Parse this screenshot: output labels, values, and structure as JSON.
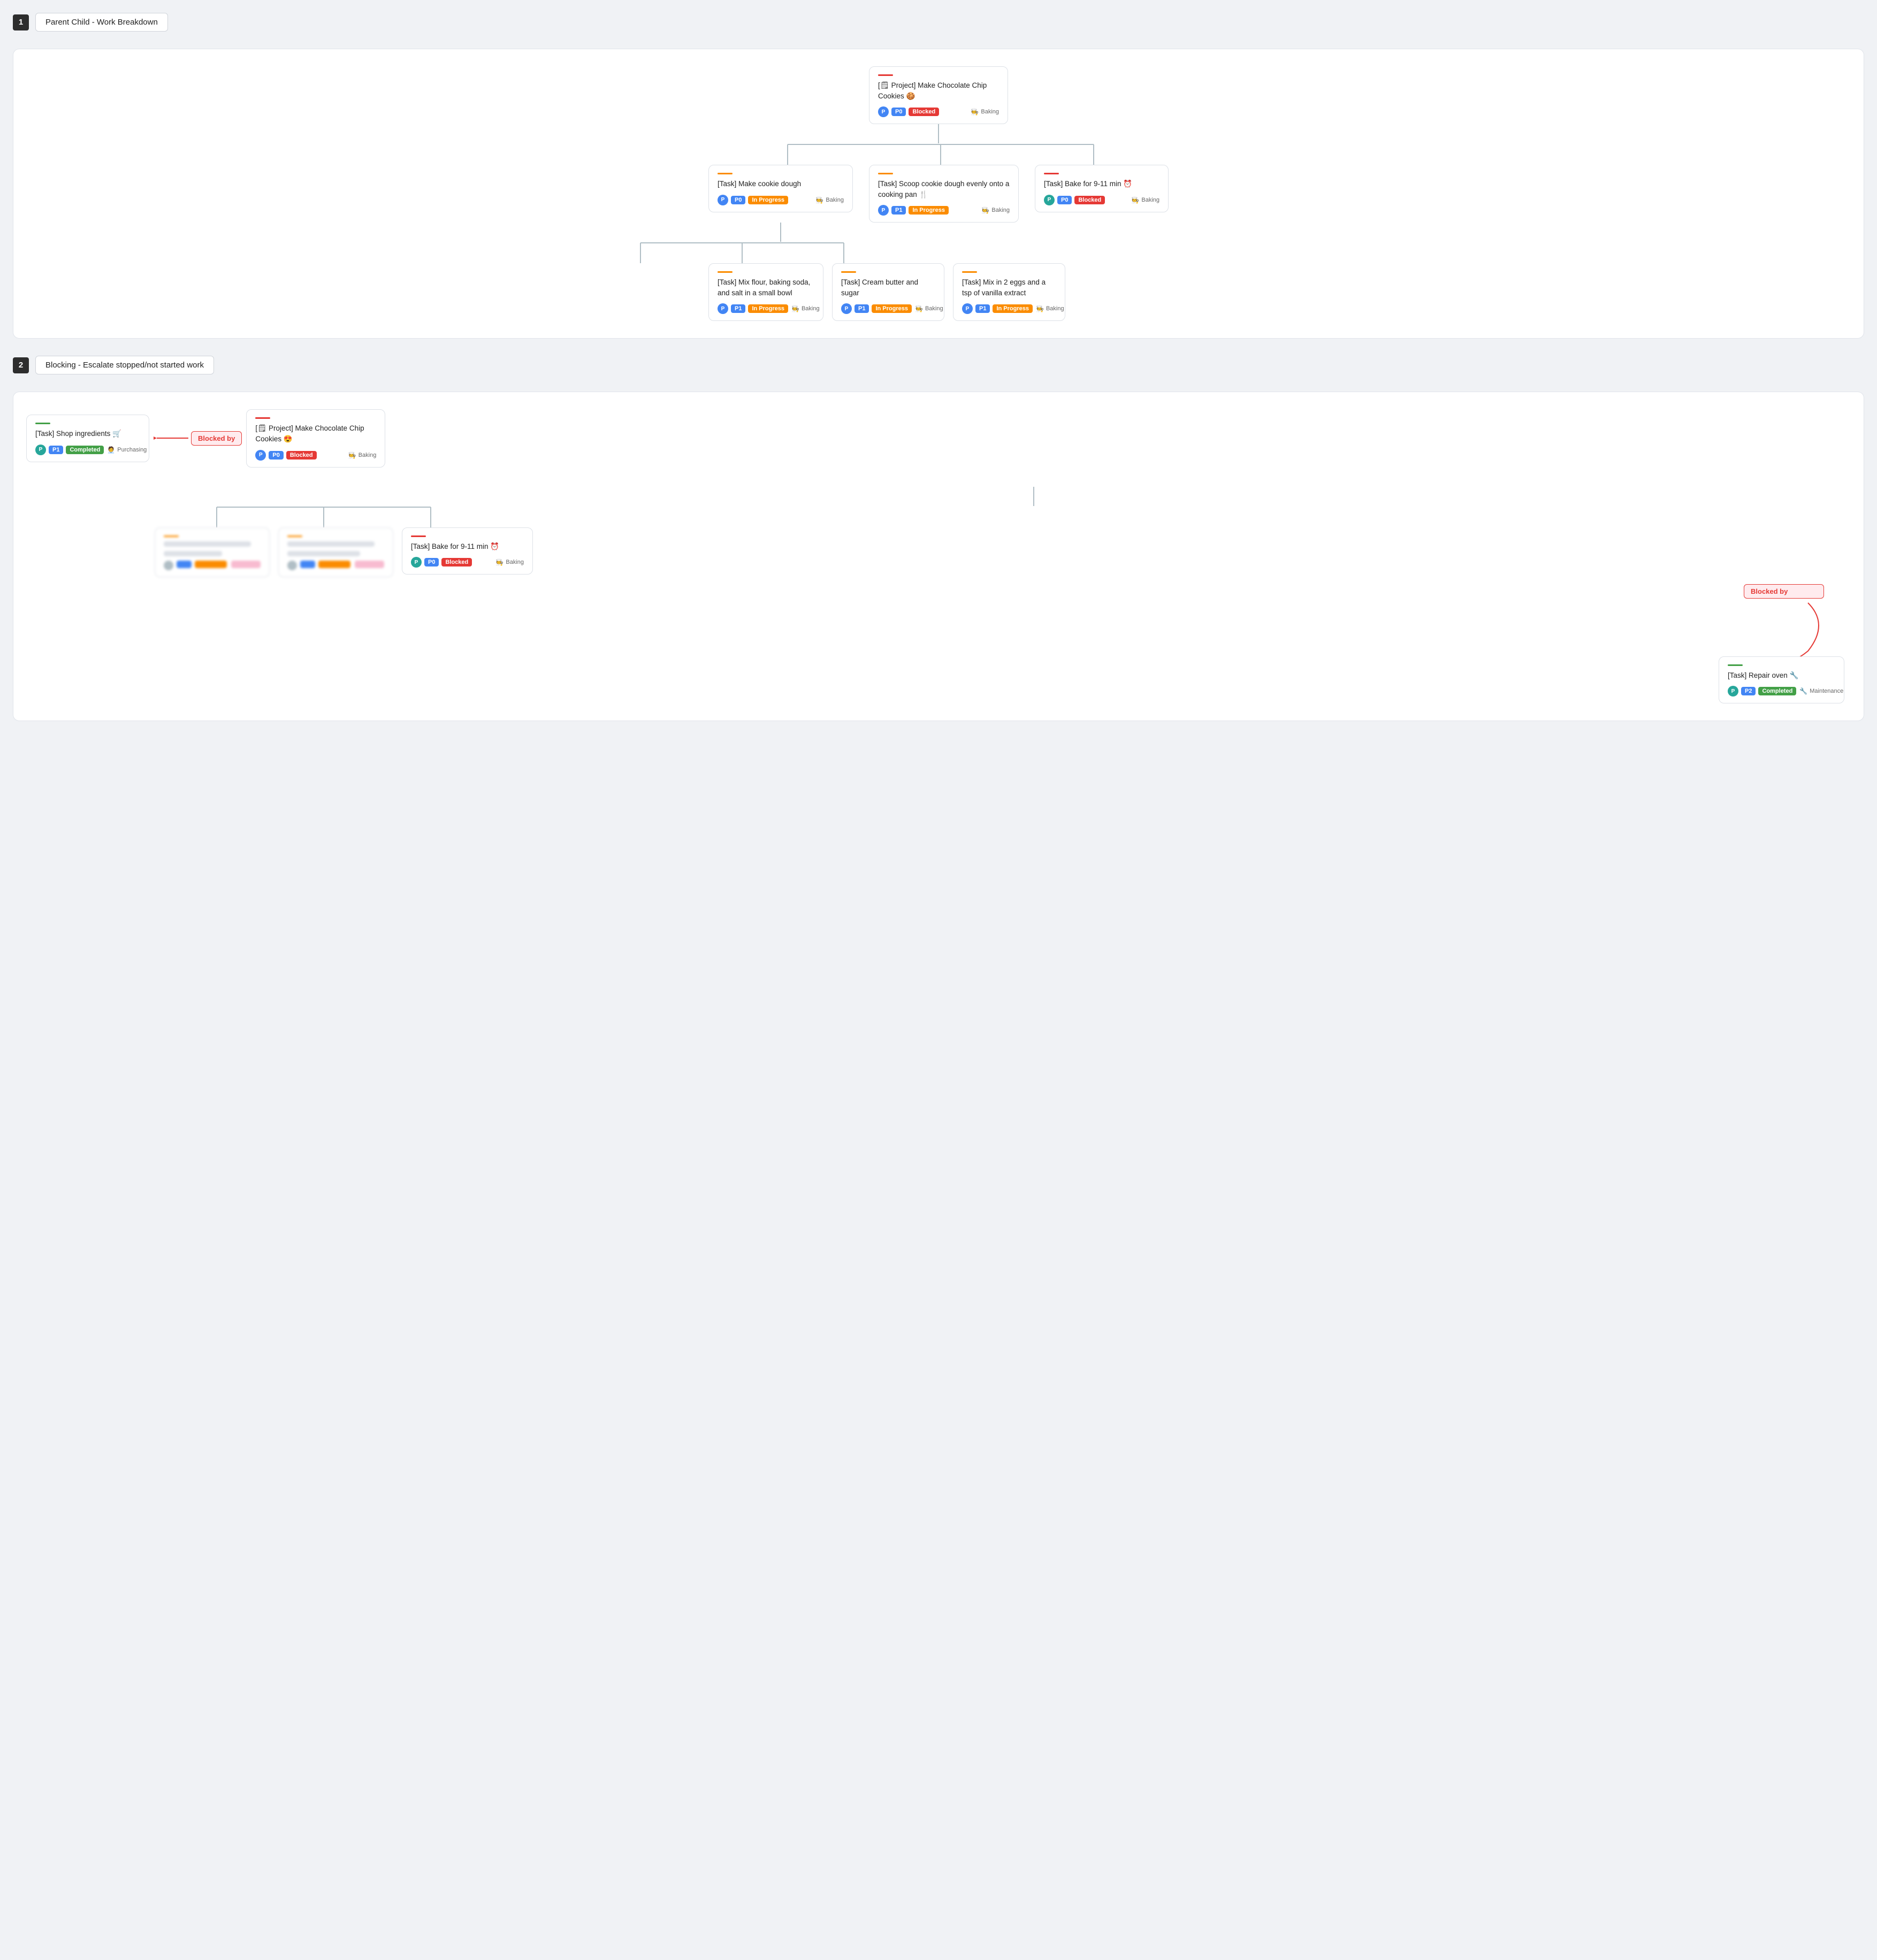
{
  "section1": {
    "number": "1",
    "title": "Parent Child - Work Breakdown",
    "root": {
      "accent": "accent-red",
      "title": "[🗒 Project] Make Chocolate Chip Cookies 🍪",
      "avatar": "P",
      "avatar_class": "avatar-blue",
      "p_badge": "P0",
      "p_badge_class": "badge-p0",
      "status": "Blocked",
      "status_class": "badge-blocked",
      "team": "🧑‍🍳 Baking"
    },
    "level1": [
      {
        "accent": "accent-orange",
        "title": "[Task] Make cookie dough",
        "avatar": "P",
        "avatar_class": "avatar-blue",
        "p_badge": "P0",
        "p_badge_class": "badge-p0",
        "status": "In Progress",
        "status_class": "badge-inprogress",
        "team": "🧑‍🍳 Baking",
        "has_children": true
      },
      {
        "accent": "accent-orange",
        "title": "[Task] Scoop cookie dough evenly onto a cooking pan 🍴",
        "avatar": "P",
        "avatar_class": "avatar-blue",
        "p_badge": "P1",
        "p_badge_class": "badge-p1",
        "status": "In Progress",
        "status_class": "badge-inprogress",
        "team": "🧑‍🍳 Baking",
        "has_children": false
      },
      {
        "accent": "accent-red",
        "title": "[Task] Bake for 9-11 min ⏰",
        "avatar": "P",
        "avatar_class": "avatar-teal",
        "p_badge": "P0",
        "p_badge_class": "badge-p0",
        "status": "Blocked",
        "status_class": "badge-blocked",
        "team": "🧑‍🍳 Baking",
        "has_children": false
      }
    ],
    "level2": [
      {
        "accent": "accent-orange",
        "title": "[Task] Mix flour, baking soda, and salt in a small bowl",
        "avatar": "P",
        "avatar_class": "avatar-blue",
        "p_badge": "P1",
        "p_badge_class": "badge-p1",
        "status": "In Progress",
        "status_class": "badge-inprogress",
        "team": "🧑‍🍳 Baking"
      },
      {
        "accent": "accent-orange",
        "title": "[Task] Cream butter and sugar",
        "avatar": "P",
        "avatar_class": "avatar-blue",
        "p_badge": "P1",
        "p_badge_class": "badge-p1",
        "status": "In Progress",
        "status_class": "badge-inprogress",
        "team": "🧑‍🍳 Baking"
      },
      {
        "accent": "accent-orange",
        "title": "[Task] Mix in 2 eggs and a tsp of vanilla extract",
        "avatar": "P",
        "avatar_class": "avatar-blue",
        "p_badge": "P1",
        "p_badge_class": "badge-p1",
        "status": "In Progress",
        "status_class": "badge-inprogress",
        "team": "🧑‍🍳 Baking"
      }
    ]
  },
  "section2": {
    "number": "2",
    "title": "Blocking - Escalate stopped/not started work",
    "shop_card": {
      "accent": "accent-green",
      "title": "[Task] Shop ingredients 🛒",
      "avatar": "P",
      "avatar_class": "avatar-teal",
      "p_badge": "P1",
      "p_badge_class": "badge-p1",
      "status": "Completed",
      "status_class": "badge-completed",
      "team": "🧑‍💼 Purchasing"
    },
    "blocked_by_label": "Blocked by",
    "project_card": {
      "accent": "accent-red",
      "title": "[🗒 Project] Make Chocolate Chip Cookies 😍",
      "avatar": "P",
      "avatar_class": "avatar-blue",
      "p_badge": "P0",
      "p_badge_class": "badge-p0",
      "status": "Blocked",
      "status_class": "badge-blocked",
      "team": "🧑‍🍳 Baking"
    },
    "bake_card": {
      "accent": "accent-red",
      "title": "[Task] Bake for 9-11 min ⏰",
      "avatar": "P",
      "avatar_class": "avatar-teal",
      "p_badge": "P0",
      "p_badge_class": "badge-p0",
      "status": "Blocked",
      "status_class": "badge-blocked",
      "team": "🧑‍🍳 Baking"
    },
    "blocked_by_label2": "Blocked by",
    "repair_card": {
      "accent": "accent-green",
      "title": "[Task] Repair oven 🔧",
      "avatar": "P",
      "avatar_class": "avatar-teal",
      "p_badge": "P2",
      "p_badge_class": "badge-p2",
      "status": "Completed",
      "status_class": "badge-completed",
      "team": "🔧 Maintenance"
    }
  }
}
